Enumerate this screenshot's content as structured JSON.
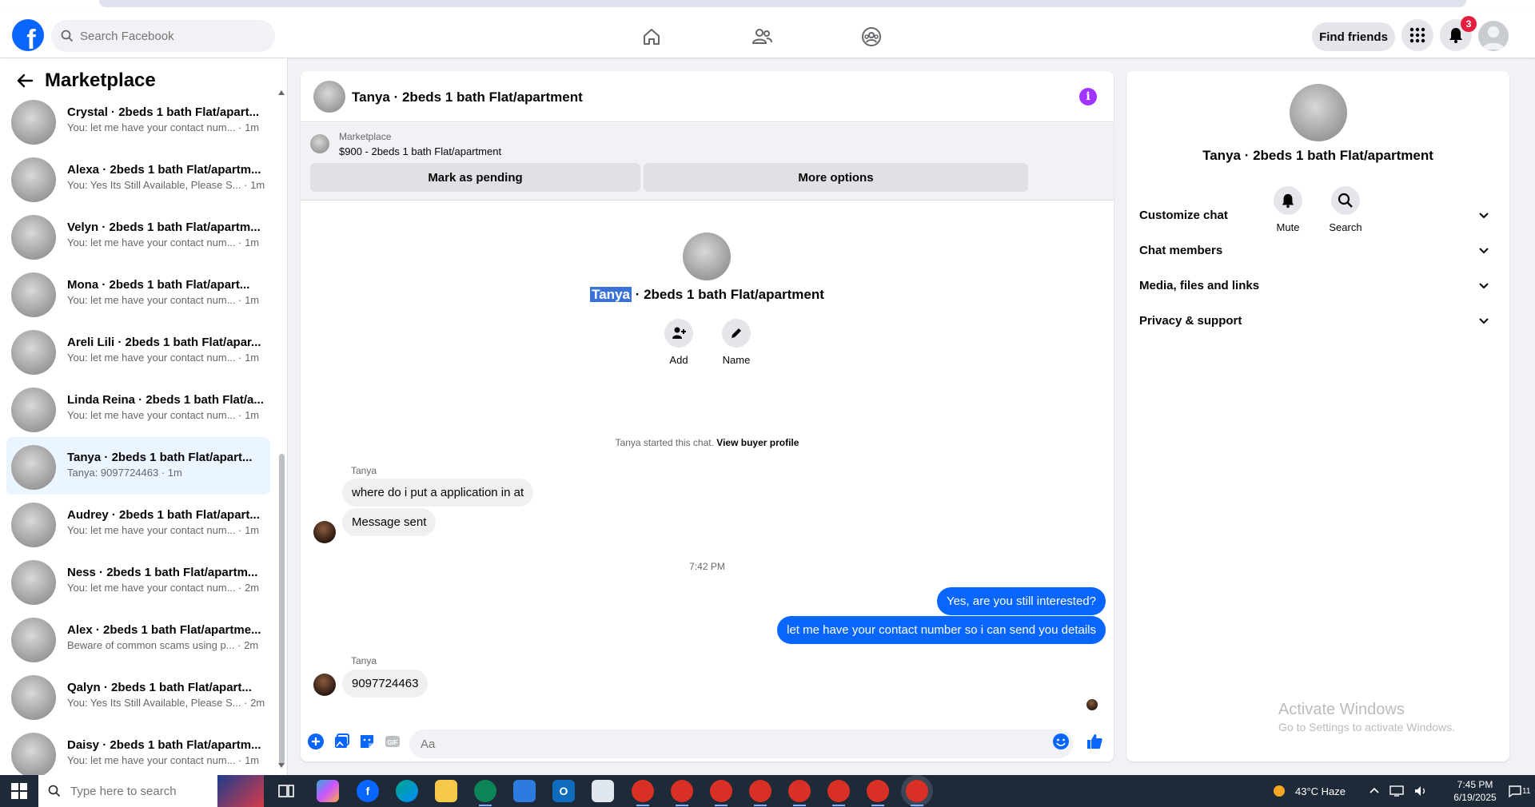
{
  "header": {
    "logo_letter": "f",
    "search_placeholder": "Search Facebook",
    "find_friends": "Find friends",
    "notifications_count": "3"
  },
  "sidebar": {
    "title": "Marketplace",
    "conversations": [
      {
        "name": "Crystal · 2beds 1 bath Flat/apart...",
        "preview": "You: let me have your contact num... · 1m",
        "active": false
      },
      {
        "name": "Alexa · 2beds 1 bath Flat/apartm...",
        "preview": "You: Yes Its Still Available, Please S... · 1m",
        "active": false
      },
      {
        "name": "Velyn · 2beds 1 bath Flat/apartm...",
        "preview": "You: let me have your contact num... · 1m",
        "active": false
      },
      {
        "name": "Mona · 2beds 1 bath Flat/apart...",
        "preview": "You: let me have your contact num... · 1m",
        "active": false
      },
      {
        "name": "Areli Lili · 2beds 1 bath Flat/apar...",
        "preview": "You: let me have your contact num... · 1m",
        "active": false
      },
      {
        "name": "Linda Reina · 2beds 1 bath Flat/a...",
        "preview": "You: let me have your contact num... · 1m",
        "active": false
      },
      {
        "name": "Tanya · 2beds 1 bath Flat/apart...",
        "preview": "Tanya: 9097724463 · 1m",
        "active": true
      },
      {
        "name": "Audrey · 2beds 1 bath Flat/apart...",
        "preview": "You: let me have your contact num... · 1m",
        "active": false
      },
      {
        "name": "Ness · 2beds 1 bath Flat/apartm...",
        "preview": "You: let me have your contact num... · 2m",
        "active": false
      },
      {
        "name": "Alex · 2beds 1 bath Flat/apartme...",
        "preview": "Beware of common scams using p... · 2m",
        "active": false
      },
      {
        "name": "Qalyn · 2beds 1 bath Flat/apart...",
        "preview": "You: Yes Its Still Available, Please S... · 2m",
        "active": false
      },
      {
        "name": "Daisy · 2beds 1 bath Flat/apartm...",
        "preview": "You: let me have your contact num... · 1m",
        "active": false
      }
    ]
  },
  "chat": {
    "title": "Tanya · 2beds 1 bath Flat/apartment",
    "marketplace_label": "Marketplace",
    "listing": "$900 - 2beds 1 bath Flat/apartment",
    "mark_pending": "Mark as pending",
    "more_options": "More options",
    "intro_highlight": "Tanya",
    "intro_rest": " · 2beds 1 bath Flat/apartment",
    "add_label": "Add",
    "name_label": "Name",
    "system_text": "Tanya started this chat. ",
    "system_link": "View buyer profile",
    "sender1": "Tanya",
    "msg1": "where do i put a application in at",
    "msg2": "Message sent",
    "time": "7:42 PM",
    "out1": "Yes, are you still interested?",
    "out2": "let me have your contact number so i can send you details",
    "sender2": "Tanya",
    "msg3": "9097724463",
    "input_placeholder": "Aa"
  },
  "info": {
    "name": "Tanya · 2beds 1 bath Flat/apartment",
    "mute": "Mute",
    "search": "Search",
    "sections": [
      "Customize chat",
      "Chat members",
      "Media, files and links",
      "Privacy & support"
    ],
    "activate_title": "Activate Windows",
    "activate_sub": "Go to Settings to activate Windows."
  },
  "taskbar": {
    "search_placeholder": "Type here to search",
    "weather": "43°C  Haze",
    "time": "7:45 PM",
    "date": "6/19/2025",
    "notif_count": "11"
  },
  "colors": {
    "brand": "#0866ff",
    "outgoing": "#0866ff",
    "active_convo": "#ebf5ff",
    "badge": "#e41e3f",
    "info": "#a033ff"
  }
}
